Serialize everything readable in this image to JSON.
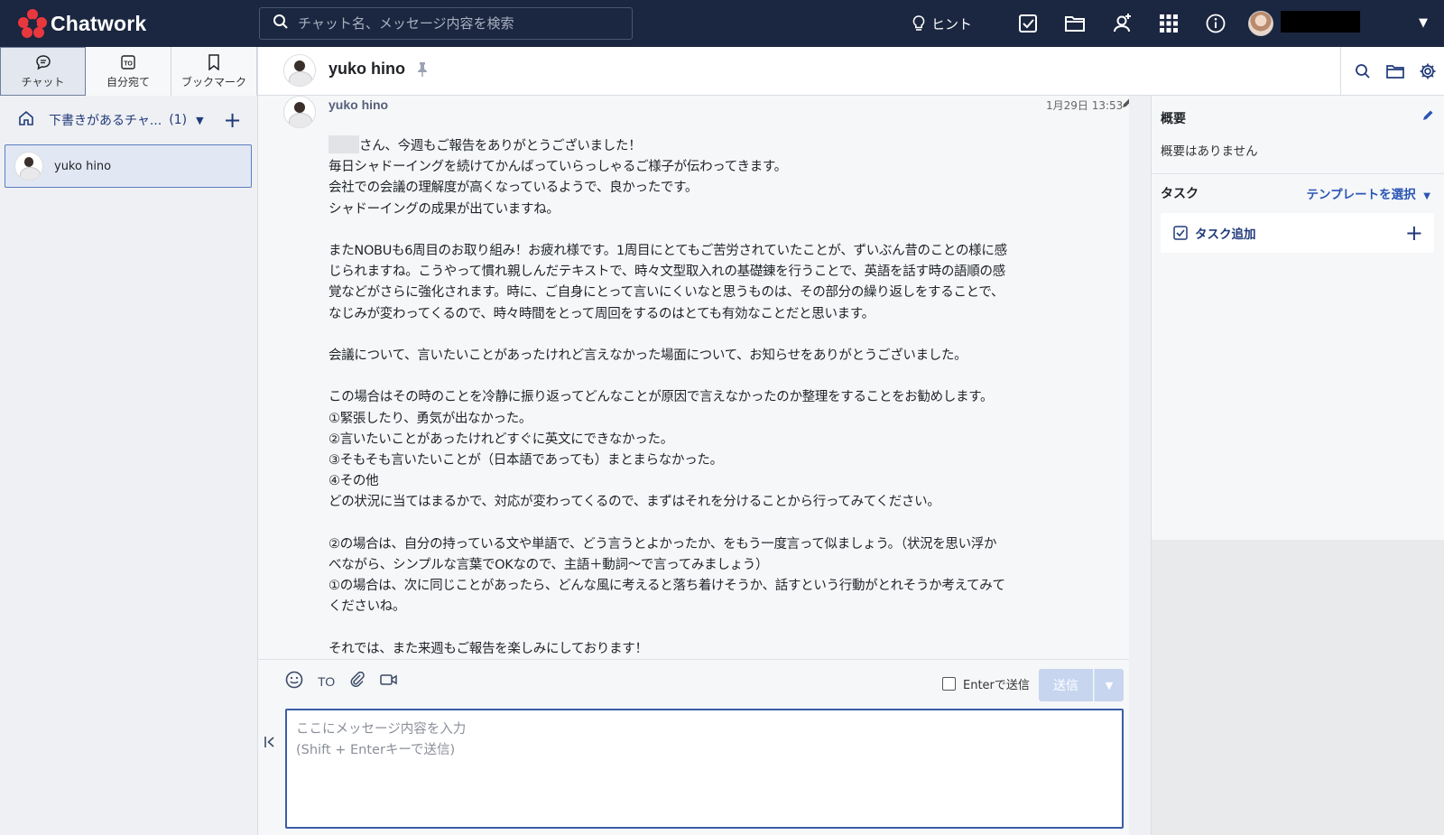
{
  "app": {
    "brand": "Chatwork",
    "search_placeholder": "チャット名、メッセージ内容を検索",
    "hint_label": "ヒント"
  },
  "sidebar": {
    "tabs": [
      {
        "label": "チャット",
        "icon": "chat-bubble-icon",
        "active": true
      },
      {
        "label": "自分宛て",
        "icon": "to-icon",
        "active": false
      },
      {
        "label": "ブックマーク",
        "icon": "bookmark-icon",
        "active": false
      }
    ],
    "filter": {
      "label": "下書きがあるチャ...",
      "count": "(1)"
    },
    "rooms": [
      {
        "name": "yuko hino"
      }
    ]
  },
  "chat": {
    "title": "yuko hino",
    "message": {
      "sender": "yuko hino",
      "time": "1月29日 13:53",
      "lines": [
        "さん、今週もご報告をありがとうございました！",
        "毎日シャドーイングを続けてかんばっていらっしゃるご様子が伝わってきます。",
        "会社での会議の理解度が高くなっているようで、良かったです。",
        "シャドーイングの成果が出ていますね。",
        "",
        "またNOBUも6周目のお取り組み！お疲れ様です。1周目にとてもご苦労されていたことが、ずいぶん昔のことの様に感",
        "じられますね。こうやって慣れ親しんだテキストで、時々文型取入れの基礎錬を行うことで、英語を話す時の語順の感",
        "覚などがさらに強化されます。時に、ご自身にとって言いにくいなと思うものは、その部分の繰り返しをすることで、",
        "なじみが変わってくるので、時々時間をとって周回をするのはとても有効なことだと思います。",
        "",
        "会議について、言いたいことがあったけれど言えなかった場面について、お知らせをありがとうございました。",
        "",
        "この場合はその時のことを冷静に振り返ってどんなことが原因で言えなかったのか整理をすることをお勧めします。",
        "①緊張したり、勇気が出なかった。",
        "②言いたいことがあったけれどすぐに英文にできなかった。",
        "③そもそも言いたいことが（日本語であっても）まとまらなかった。",
        "④その他",
        "どの状況に当てはまるかで、対応が変わってくるので、まずはそれを分けることから行ってみてください。",
        "",
        "②の場合は、自分の持っている文や単語で、どう言うとよかったか、をもう一度言って似ましょう。（状況を思い浮か",
        "べながら、シンプルな言葉でOKなので、主語＋動詞〜で言ってみましょう）",
        "①の場合は、次に同じことがあったら、どんな風に考えると落ち着けそうか、話すという行動がとれそうか考えてみて",
        "くださいね。",
        "",
        "それでは、また来週もご報告を楽しみにしております！"
      ]
    }
  },
  "composer": {
    "to_label": "TO",
    "enter_send_label": "Enterで送信",
    "send_label": "送信",
    "placeholder": "ここにメッセージ内容を入力\n(Shift + Enterキーで送信)"
  },
  "rightpanel": {
    "summary_title": "概要",
    "summary_text": "概要はありません",
    "task_title": "タスク",
    "template_label": "テンプレートを選択",
    "task_add_label": "タスク追加"
  },
  "colors": {
    "topbar": "#1b2640",
    "accent": "#2a55b5",
    "send_disabled": "#c7d5ef",
    "logo_red": "#e8383d"
  }
}
